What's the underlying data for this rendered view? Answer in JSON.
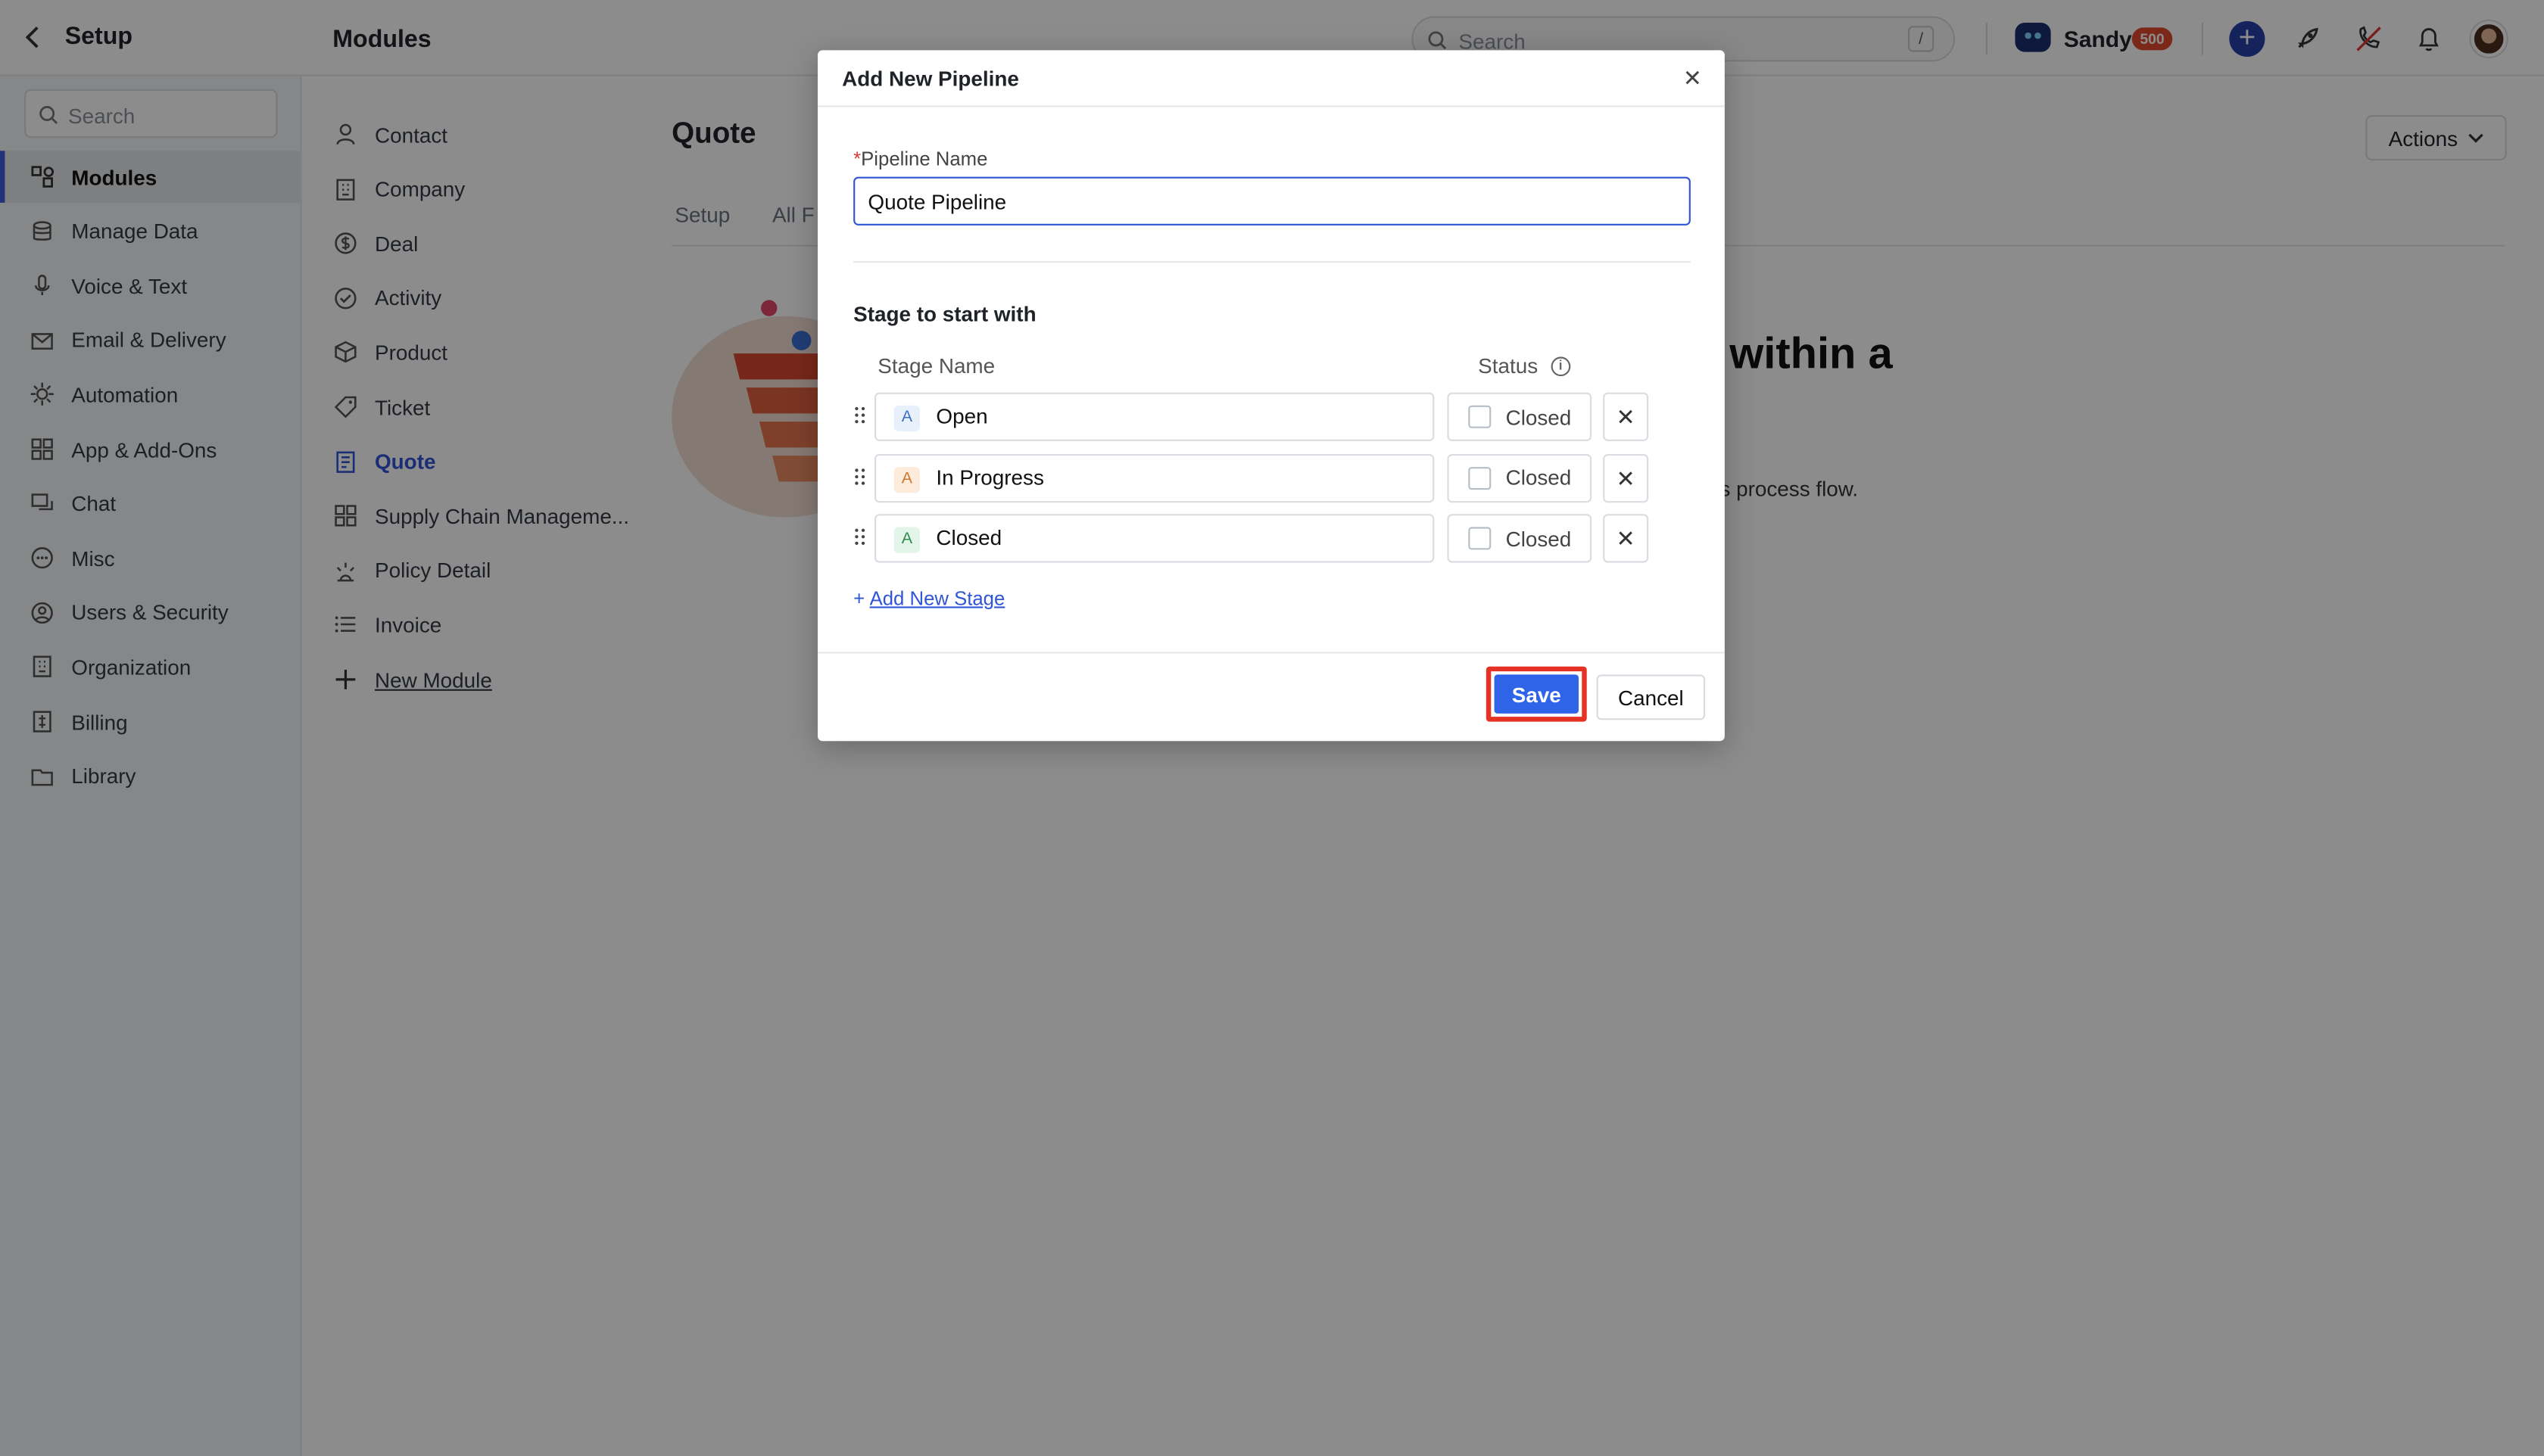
{
  "header": {
    "setup_title": "Setup",
    "modules_title": "Modules",
    "search_placeholder": "Search",
    "search_shortcut": "/",
    "user_name": "Sandy",
    "credits_badge": "500"
  },
  "sidebar": {
    "search_placeholder": "Search",
    "items": [
      {
        "label": "Modules",
        "icon": "modules-icon",
        "active": true
      },
      {
        "label": "Manage Data",
        "icon": "database-icon"
      },
      {
        "label": "Voice & Text",
        "icon": "microphone-icon"
      },
      {
        "label": "Email & Delivery",
        "icon": "mail-icon"
      },
      {
        "label": "Automation",
        "icon": "automation-icon"
      },
      {
        "label": "App & Add-Ons",
        "icon": "apps-grid-icon"
      },
      {
        "label": "Chat",
        "icon": "chat-icon"
      },
      {
        "label": "Misc",
        "icon": "more-circle-icon"
      },
      {
        "label": "Users & Security",
        "icon": "user-circle-icon"
      },
      {
        "label": "Organization",
        "icon": "building-icon"
      },
      {
        "label": "Billing",
        "icon": "billing-icon"
      },
      {
        "label": "Library",
        "icon": "folder-icon"
      }
    ]
  },
  "modules": {
    "items": [
      {
        "label": "Contact",
        "icon": "person-icon"
      },
      {
        "label": "Company",
        "icon": "building-icon"
      },
      {
        "label": "Deal",
        "icon": "dollar-icon"
      },
      {
        "label": "Activity",
        "icon": "check-circle-icon"
      },
      {
        "label": "Product",
        "icon": "box-icon"
      },
      {
        "label": "Ticket",
        "icon": "tag-icon"
      },
      {
        "label": "Quote",
        "icon": "document-icon",
        "active": true
      },
      {
        "label": "Supply Chain Manageme...",
        "icon": "grid-icon"
      },
      {
        "label": "Policy Detail",
        "icon": "policy-icon"
      },
      {
        "label": "Invoice",
        "icon": "list-icon"
      },
      {
        "label": "New Module",
        "icon": "plus-icon"
      }
    ]
  },
  "main": {
    "page_title": "Quote",
    "actions_label": "Actions",
    "tabs": [
      "Setup",
      "All F"
    ],
    "hero_title": "within a",
    "hero_subtitle": "s process flow."
  },
  "modal": {
    "title": "Add New Pipeline",
    "name_label_required": "*",
    "name_label": "Pipeline Name",
    "name_value": "Quote Pipeline",
    "stage_header": "Stage to start with",
    "col_stage_name": "Stage Name",
    "col_status": "Status",
    "stages": [
      {
        "badge": "A",
        "name": "Open",
        "status_label": "Closed",
        "badge_bg": "#e7f0fb",
        "badge_fg": "#3c6fc4"
      },
      {
        "badge": "A",
        "name": "In Progress",
        "status_label": "Closed",
        "badge_bg": "#fdecdc",
        "badge_fg": "#d2762b"
      },
      {
        "badge": "A",
        "name": "Closed",
        "status_label": "Closed",
        "badge_bg": "#e3f4e8",
        "badge_fg": "#2f8a4d"
      }
    ],
    "add_stage_label": "Add New Stage",
    "save_label": "Save",
    "cancel_label": "Cancel"
  }
}
